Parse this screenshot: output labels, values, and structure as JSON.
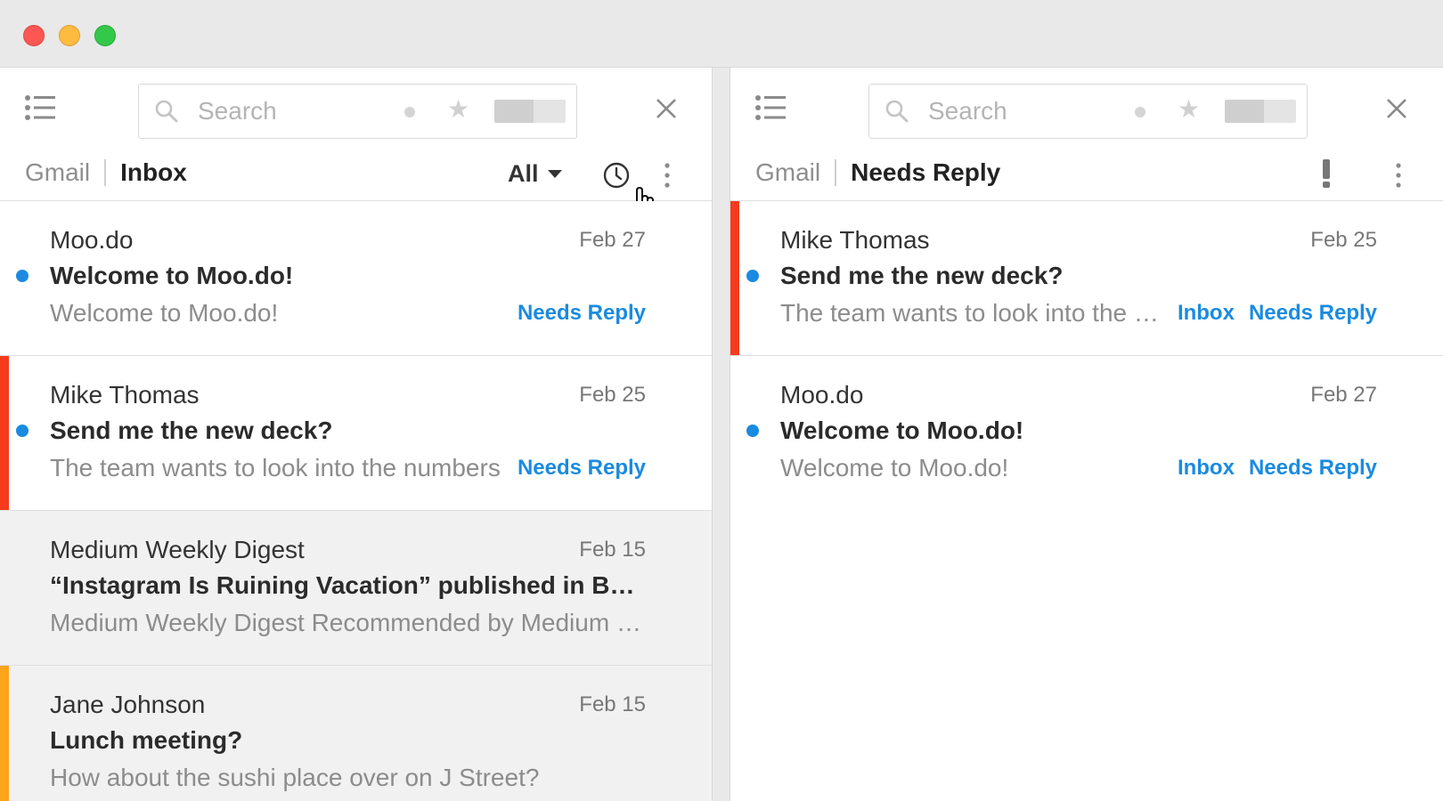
{
  "colors": {
    "accent": "#1a8be0",
    "red_flag": "#f63b1d",
    "orange_flag": "#fea41a"
  },
  "left_pane": {
    "search": {
      "placeholder": "Search"
    },
    "breadcrumb": {
      "root": "Gmail",
      "current": "Inbox"
    },
    "filter": {
      "selected": "All"
    },
    "emails": [
      {
        "sender": "Moo.do",
        "date": "Feb 27",
        "subject": "Welcome to Moo.do!",
        "snippet": "Welcome to Moo.do!",
        "labels": [
          "Needs Reply"
        ],
        "unread": true,
        "flag": ""
      },
      {
        "sender": "Mike Thomas",
        "date": "Feb 25",
        "subject": "Send me the new deck?",
        "snippet": "The team wants to look into the numbers",
        "labels": [
          "Needs Reply"
        ],
        "unread": true,
        "flag": "red"
      },
      {
        "sender": "Medium Weekly Digest",
        "date": "Feb 15",
        "subject": "“Instagram Is Ruining Vacation” published in Backchannel",
        "snippet": "Medium Weekly Digest Recommended by Medium for you",
        "labels": [],
        "unread": false,
        "flag": ""
      },
      {
        "sender": "Jane Johnson",
        "date": "Feb 15",
        "subject": "Lunch meeting?",
        "snippet": "How about the sushi place over on J Street?",
        "labels": [],
        "unread": false,
        "flag": "orange"
      }
    ]
  },
  "right_pane": {
    "search": {
      "placeholder": "Search"
    },
    "breadcrumb": {
      "root": "Gmail",
      "current": "Needs Reply"
    },
    "emails": [
      {
        "sender": "Mike Thomas",
        "date": "Feb 25",
        "subject": "Send me the new deck?",
        "snippet": "The team wants to look into the numbers",
        "labels": [
          "Inbox",
          "Needs Reply"
        ],
        "unread": true,
        "flag": "red"
      },
      {
        "sender": "Moo.do",
        "date": "Feb 27",
        "subject": "Welcome to Moo.do!",
        "snippet": "Welcome to Moo.do!",
        "labels": [
          "Inbox",
          "Needs Reply"
        ],
        "unread": true,
        "flag": ""
      }
    ]
  }
}
